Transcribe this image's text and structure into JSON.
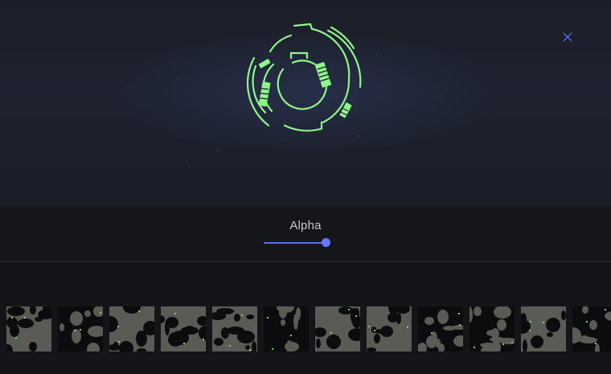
{
  "preview": {
    "close_icon": "close-icon",
    "logo_icon": "radial-hud-logo-icon",
    "accent_color": "#8ef58a"
  },
  "controls": {
    "slider_label": "Alpha",
    "slider_value": 0.92,
    "slider_color": "#6577ff"
  },
  "gallery": {
    "thumbnails": [
      {
        "name": "texture-1"
      },
      {
        "name": "texture-2"
      },
      {
        "name": "texture-3"
      },
      {
        "name": "texture-4"
      },
      {
        "name": "texture-5"
      },
      {
        "name": "texture-6"
      },
      {
        "name": "texture-7"
      },
      {
        "name": "texture-8"
      },
      {
        "name": "texture-9"
      },
      {
        "name": "texture-10"
      },
      {
        "name": "texture-11"
      },
      {
        "name": "texture-12"
      }
    ]
  }
}
